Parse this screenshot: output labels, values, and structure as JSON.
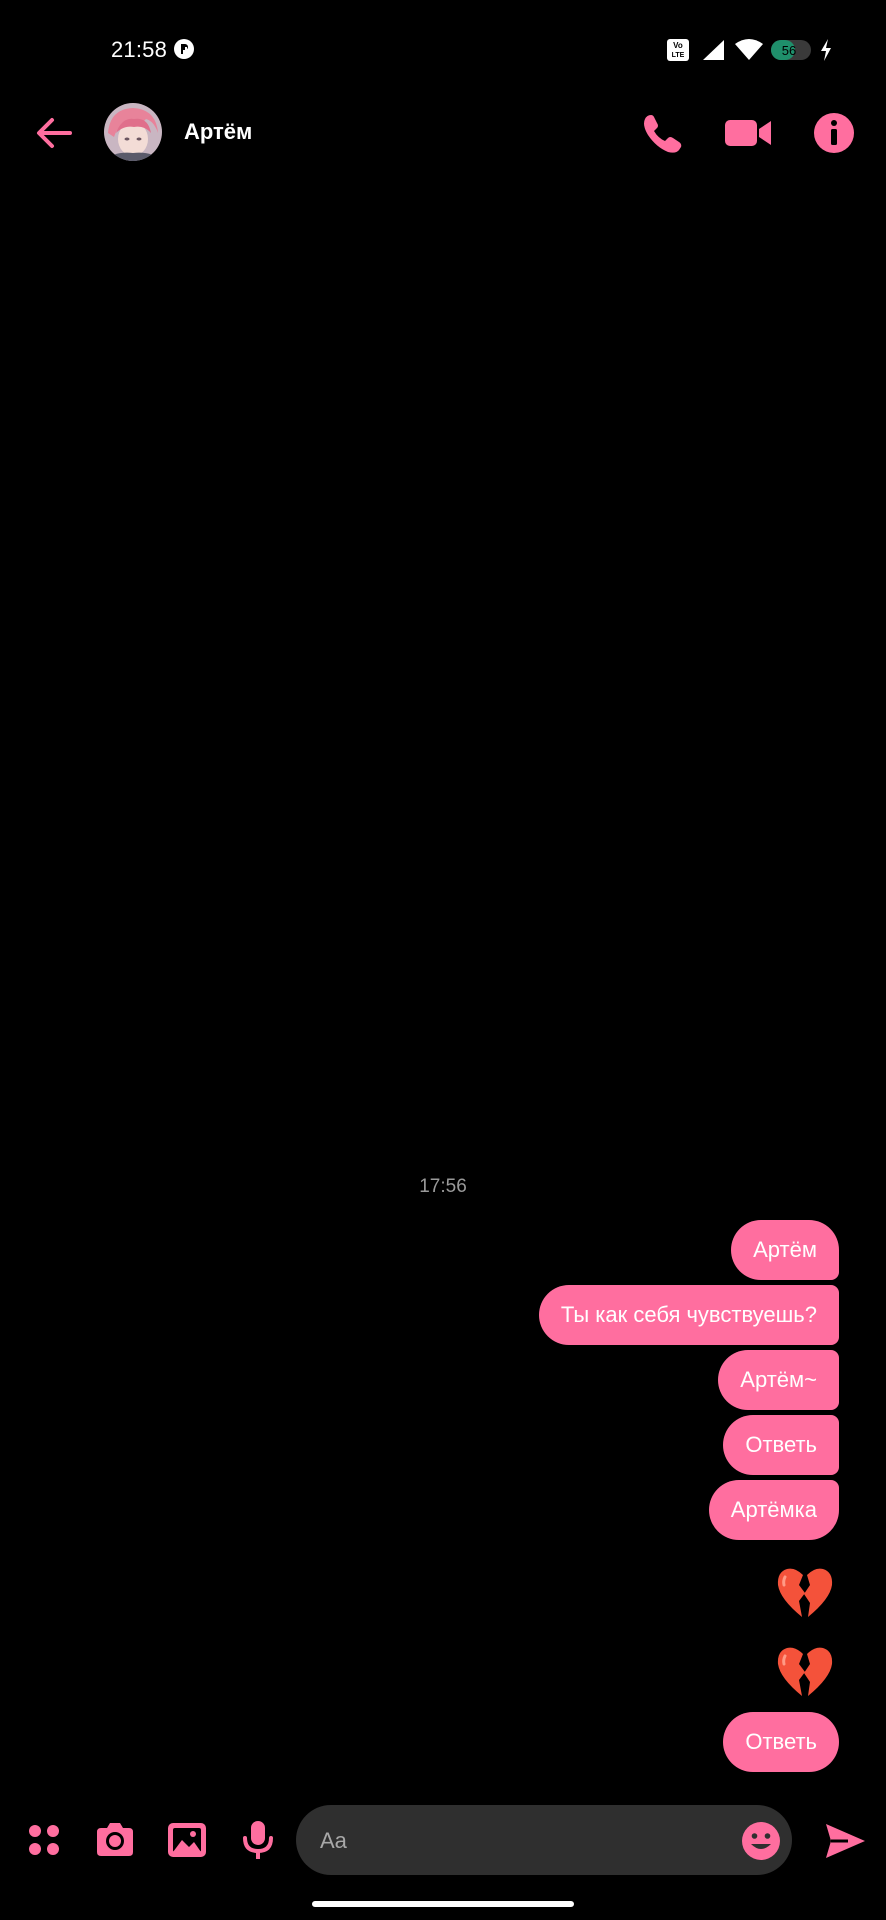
{
  "status_bar": {
    "time": "21:58",
    "battery": "56",
    "volte_top": "Vo",
    "volte_bottom": "LTE"
  },
  "header": {
    "contact_name": "Артём"
  },
  "conversation": {
    "timestamp": "17:56",
    "messages": [
      {
        "text": "Артём"
      },
      {
        "text": "Ты как себя чувствуешь?"
      },
      {
        "text": "Артём~"
      },
      {
        "text": "Ответь"
      },
      {
        "text": "Артёмка"
      },
      {
        "emoji": "broken-heart"
      },
      {
        "emoji": "broken-heart"
      },
      {
        "text": "Ответь"
      }
    ]
  },
  "composer": {
    "placeholder": "Aa"
  },
  "colors": {
    "accent": "#ff6e9f",
    "background": "#000000",
    "input_bg": "#2f2f2f",
    "battery_fill": "#1f8f6b"
  }
}
